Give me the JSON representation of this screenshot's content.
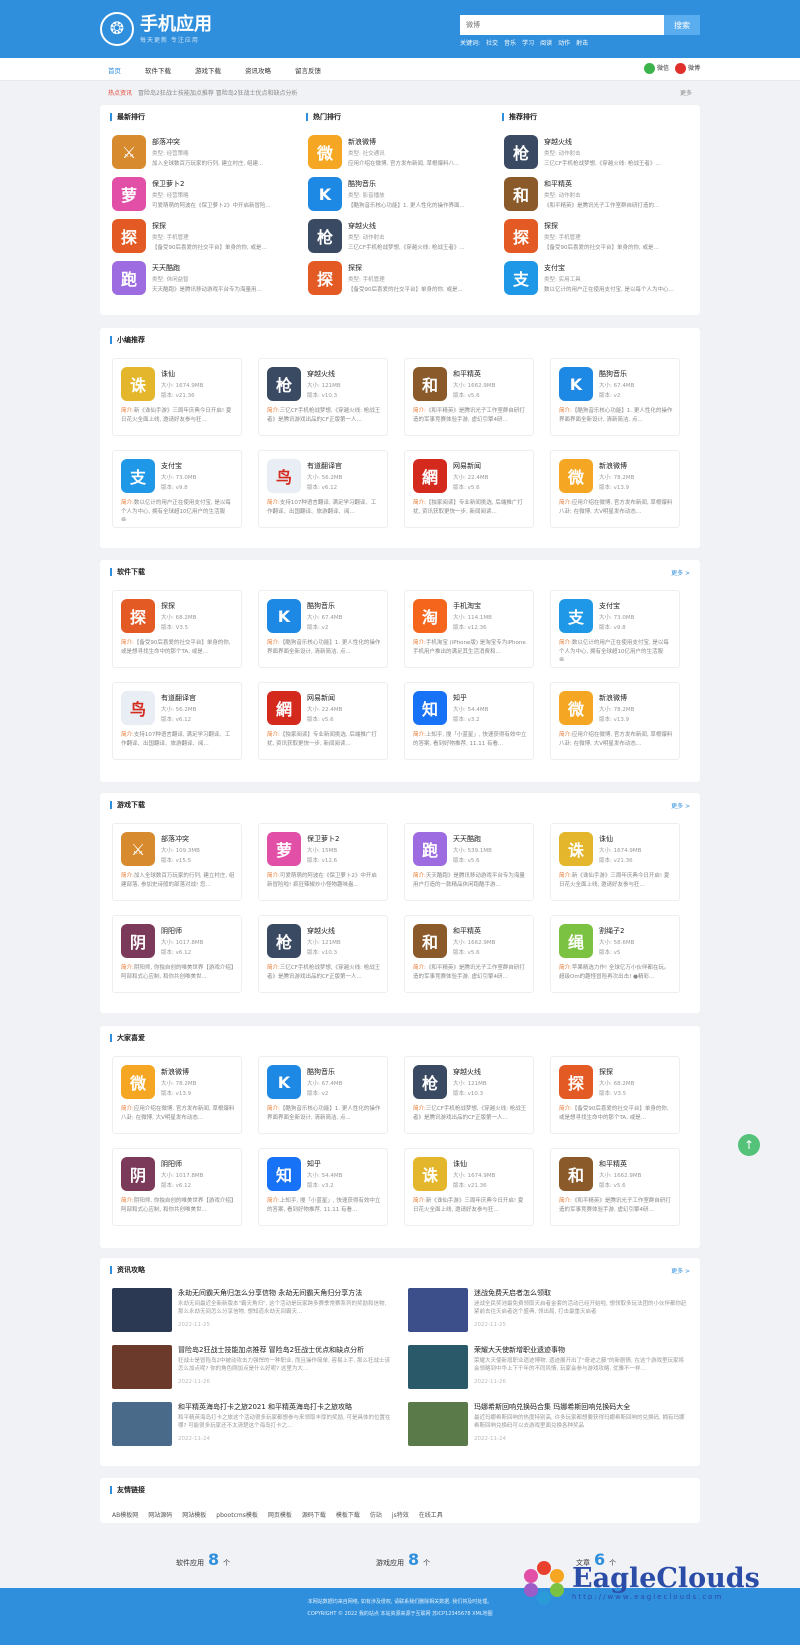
{
  "header": {
    "logo_text": "手机应用",
    "logo_sub": "每天更新  专注应用",
    "search_placeholder": "微博",
    "search_button": "搜索",
    "keywords_label": "关键词:",
    "keywords": [
      "社交",
      "音乐",
      "学习",
      "阅读",
      "动作",
      "射击"
    ]
  },
  "nav": {
    "items": [
      "首页",
      "软件下载",
      "游戏下载",
      "资讯攻略",
      "留言反馈"
    ],
    "share": [
      "微信",
      "微博"
    ]
  },
  "ticker": {
    "label": "热点资讯",
    "text": "冒险岛2狂战士技能加点推荐 冒险岛2狂战士优点和缺点分析",
    "more": "更多"
  },
  "rankings": [
    {
      "title": "最新排行",
      "items": [
        {
          "name": "部落冲突",
          "sub": "类型: 经营策略",
          "desc": "加入全球数百万玩家的行列, 建立村庄, 组建...",
          "icon": "⚔",
          "color": "#d88a2e"
        },
        {
          "name": "保卫萝卜2",
          "sub": "类型: 经营策略",
          "desc": "可爱萌萌的阿波在《保卫萝卜2》中开启新冒险...",
          "icon": "萝",
          "color": "#e24fa7"
        },
        {
          "name": "探探",
          "sub": "类型: 手机管理",
          "desc": "【备受90后喜爱的社交平台】单身的你, 或是...",
          "icon": "探",
          "color": "#e45a24"
        },
        {
          "name": "天天酷跑",
          "sub": "类型: 休闲益智",
          "desc": "天天酷跑》是腾讯移动游戏平台专为海量用...",
          "icon": "跑",
          "color": "#9c6ce0"
        }
      ]
    },
    {
      "title": "热门排行",
      "items": [
        {
          "name": "新浪微博",
          "sub": "类型: 社交通讯",
          "desc": "应用介绍在微博, 官方发布新闻, 草根爆料八...",
          "icon": "微",
          "color": "#f5a623"
        },
        {
          "name": "酷狗音乐",
          "sub": "类型: 影音播放",
          "desc": "【酷狗音乐核心功能】1. 更人性化的操作界面...",
          "icon": "K",
          "color": "#1e88e5"
        },
        {
          "name": "穿越火线",
          "sub": "类型: 动作射击",
          "desc": "三亿CF手机枪战梦想,《穿越火线: 枪战王者》...",
          "icon": "枪",
          "color": "#3a4a63"
        },
        {
          "name": "探探",
          "sub": "类型: 手机管理",
          "desc": "【备受90后喜爱的社交平台】单身的你, 或是...",
          "icon": "探",
          "color": "#e45a24"
        }
      ]
    },
    {
      "title": "推荐排行",
      "items": [
        {
          "name": "穿越火线",
          "sub": "类型: 动作射击",
          "desc": "三亿CF手机枪战梦想,《穿越火线: 枪战王者》...",
          "icon": "枪",
          "color": "#3a4a63"
        },
        {
          "name": "和平精英",
          "sub": "类型: 动作射击",
          "desc": "《和平精英》是腾讯光子工作室群自研打造的...",
          "icon": "和",
          "color": "#8a5a2b"
        },
        {
          "name": "探探",
          "sub": "类型: 手机管理",
          "desc": "【备受90后喜爱的社交平台】单身的你, 或是...",
          "icon": "探",
          "color": "#e45a24"
        },
        {
          "name": "支付宝",
          "sub": "类型: 实用工具",
          "desc": "数以亿计的用户正在使用支付宝, 是以每个人为中心...",
          "icon": "支",
          "color": "#1f98e8"
        }
      ]
    }
  ],
  "sections": [
    {
      "title": "小编推荐",
      "more": "",
      "apps": [
        {
          "name": "诛仙",
          "size": "大小: 1674.9MB",
          "ver": "版本: v21.36",
          "desc": "新《诛仙手游》三周年庆典今日开启! 夏日花火全面上线, 邀请好友参与狂...",
          "icon": "诛",
          "color": "#e3b62b"
        },
        {
          "name": "穿越火线",
          "size": "大小: 121MB",
          "ver": "版本: v10.3",
          "desc": "三亿CF手机枪战梦想,《穿越火线: 枪战王者》是腾讯游戏出品的CF正版第一人...",
          "icon": "枪",
          "color": "#3a4a63"
        },
        {
          "name": "和平精英",
          "size": "大小: 1662.9MB",
          "ver": "版本: v5.6",
          "desc": "《和平精英》是腾讯光子工作室群自研打造的军事竞赛体验手游, 虚幻引擎4研...",
          "icon": "和",
          "color": "#8a5a2b"
        },
        {
          "name": "酷狗音乐",
          "size": "大小: 67.4MB",
          "ver": "版本: v2",
          "desc": "【酷狗音乐核心功能】1. 更人性化的操作界面界面全新设计, 清新简洁, 点...",
          "icon": "K",
          "color": "#1e88e5"
        },
        {
          "name": "支付宝",
          "size": "大小: 73.0MB",
          "ver": "版本: v9.8",
          "desc": "数以亿计的用户正在使用支付宝, 是以每个人为中心, 拥有全球超10亿用户的生活服务...",
          "icon": "支",
          "color": "#1f98e8"
        },
        {
          "name": "有道翻译官",
          "size": "大小: 56.2MB",
          "ver": "版本: v6.12",
          "desc": "支持107种语言翻译, 满足学习翻译、工作翻译、出国翻译、旅游翻译、阅...",
          "icon": "鸟",
          "color": "#e9eef4"
        },
        {
          "name": "网易新闻",
          "size": "大小: 22.4MB",
          "ver": "版本: v5.6",
          "desc": "【独家阅读】专业新闻挑选, 后端推广打扰, 资讯获取更快一步, 新闻阅读...",
          "icon": "網",
          "color": "#d42a1e"
        },
        {
          "name": "新浪微博",
          "size": "大小: 78.2MB",
          "ver": "版本: v13.9",
          "desc": "应用介绍在微博, 官方发布新闻, 草根爆料八卦; 在微博, 大V明星发布动态...",
          "icon": "微",
          "color": "#f5a623"
        }
      ]
    },
    {
      "title": "软件下载",
      "more": "更多 >",
      "apps": [
        {
          "name": "探探",
          "size": "大小: 68.2MB",
          "ver": "版本: V3.5",
          "desc": "【备受90后喜爱的社交平台】单身的你, 或是想寻找生命中的那个TA, 或是...",
          "icon": "探",
          "color": "#e45a24"
        },
        {
          "name": "酷狗音乐",
          "size": "大小: 67.4MB",
          "ver": "版本: v2",
          "desc": "【酷狗音乐核心功能】1. 更人性化的操作界面界面全新设计, 清新简洁, 点...",
          "icon": "K",
          "color": "#1e88e5"
        },
        {
          "name": "手机淘宝",
          "size": "大小: 114.1MB",
          "ver": "版本: v12.36",
          "desc": "手机淘宝 (iPhone版) 是淘宝专为iPhone手机用户推出的满足其生活消费和...",
          "icon": "淘",
          "color": "#f5651c"
        },
        {
          "name": "支付宝",
          "size": "大小: 73.0MB",
          "ver": "版本: v9.8",
          "desc": "数以亿计的用户正在使用支付宝, 是以每个人为中心, 拥有全球超10亿用户的生活服务...",
          "icon": "支",
          "color": "#1f98e8"
        },
        {
          "name": "有道翻译官",
          "size": "大小: 56.2MB",
          "ver": "版本: v6.12",
          "desc": "支持107种语言翻译, 满足学习翻译、工作翻译、出国翻译、旅游翻译、阅...",
          "icon": "鸟",
          "color": "#e9eef4"
        },
        {
          "name": "网易新闻",
          "size": "大小: 22.4MB",
          "ver": "版本: v5.6",
          "desc": "【独家阅读】专业新闻挑选, 后端推广打扰, 资讯获取更快一步, 新闻阅读...",
          "icon": "網",
          "color": "#d42a1e"
        },
        {
          "name": "知乎",
          "size": "大小: 54.4MB",
          "ver": "版本: v3.2",
          "desc": "上知乎, 搜「小蓝星」, 快速获得有效中立的答案, 看到好物推荐, 11.11 有看...",
          "icon": "知",
          "color": "#1772f6"
        },
        {
          "name": "新浪微博",
          "size": "大小: 78.2MB",
          "ver": "版本: v13.9",
          "desc": "应用介绍在微博, 官方发布新闻, 草根爆料八卦; 在微博, 大V明星发布动态...",
          "icon": "微",
          "color": "#f5a623"
        }
      ]
    },
    {
      "title": "游戏下载",
      "more": "更多 >",
      "apps": [
        {
          "name": "部落冲突",
          "size": "大小: 109.3MB",
          "ver": "版本: v15.5",
          "desc": "加入全球数百万玩家的行列, 建立村庄, 组建部落, 参加史诗般的部落对战! 您...",
          "icon": "⚔",
          "color": "#d88a2e"
        },
        {
          "name": "保卫萝卜2",
          "size": "大小: 15MB",
          "ver": "版本: v12.6",
          "desc": "可爱萌萌的阿波在《保卫萝卜2》中开启新冒险啦! 疯狂辣椒炒小怪物趣味盎...",
          "icon": "萝",
          "color": "#e24fa7"
        },
        {
          "name": "天天酷跑",
          "size": "大小: 539.1MB",
          "ver": "版本: v5.6",
          "desc": "天天酷跑》是腾讯移动游戏平台专为海量用户打造的一款精品休闲跑酷手游...",
          "icon": "跑",
          "color": "#9c6ce0"
        },
        {
          "name": "诛仙",
          "size": "大小: 1674.9MB",
          "ver": "版本: v21.36",
          "desc": "新《诛仙手游》三周年庆典今日开启! 夏日花火全面上线, 邀请好友参与狂...",
          "icon": "诛",
          "color": "#e3b62b"
        },
        {
          "name": "阴阳师",
          "size": "大小: 1017.8MB",
          "ver": "版本: v6.12",
          "desc": "阴阳师, 你独自创的唯美世界【游戏介绍】阿部和式心应制, 和你共创唯美世...",
          "icon": "阴",
          "color": "#7c3a5a"
        },
        {
          "name": "穿越火线",
          "size": "大小: 121MB",
          "ver": "版本: v10.3",
          "desc": "三亿CF手机枪战梦想,《穿越火线: 枪战王者》是腾讯游戏出品的CF正版第一人...",
          "icon": "枪",
          "color": "#3a4a63"
        },
        {
          "name": "和平精英",
          "size": "大小: 1662.9MB",
          "ver": "版本: v5.6",
          "desc": "《和平精英》是腾讯光子工作室群自研打造的军事竞赛体验手游, 虚幻引擎4研...",
          "icon": "和",
          "color": "#8a5a2b"
        },
        {
          "name": "割绳子2",
          "size": "大小: 58.6MB",
          "ver": "版本: v5",
          "desc": "苹果精选力作! 全球亿万小伙伴都在玩。超级Om的趣怪冒险再次出击! ●精彩...",
          "icon": "绳",
          "color": "#7cc242"
        }
      ]
    },
    {
      "title": "大家喜爱",
      "more": "",
      "apps": [
        {
          "name": "新浪微博",
          "size": "大小: 78.2MB",
          "ver": "版本: v13.9",
          "desc": "应用介绍在微博, 官方发布新闻, 草根爆料八卦; 在微博, 大V明星发布动态...",
          "icon": "微",
          "color": "#f5a623"
        },
        {
          "name": "酷狗音乐",
          "size": "大小: 67.4MB",
          "ver": "版本: v2",
          "desc": "【酷狗音乐核心功能】1. 更人性化的操作界面界面全新设计, 清新简洁, 点...",
          "icon": "K",
          "color": "#1e88e5"
        },
        {
          "name": "穿越火线",
          "size": "大小: 121MB",
          "ver": "版本: v10.3",
          "desc": "三亿CF手机枪战梦想,《穿越火线: 枪战王者》是腾讯游戏出品的CF正版第一人...",
          "icon": "枪",
          "color": "#3a4a63"
        },
        {
          "name": "探探",
          "size": "大小: 68.2MB",
          "ver": "版本: V3.5",
          "desc": "【备受90后喜爱的社交平台】单身的你, 或是想寻找生命中的那个TA, 或是...",
          "icon": "探",
          "color": "#e45a24"
        },
        {
          "name": "阴阳师",
          "size": "大小: 1017.8MB",
          "ver": "版本: v6.12",
          "desc": "阴阳师, 你独自创的唯美世界【游戏介绍】阿部和式心应制, 和你共创唯美世...",
          "icon": "阴",
          "color": "#7c3a5a"
        },
        {
          "name": "知乎",
          "size": "大小: 54.4MB",
          "ver": "版本: v3.2",
          "desc": "上知乎, 搜「小蓝星」, 快速获得有效中立的答案, 看到好物推荐, 11.11 有看...",
          "icon": "知",
          "color": "#1772f6"
        },
        {
          "name": "诛仙",
          "size": "大小: 1674.9MB",
          "ver": "版本: v21.36",
          "desc": "新《诛仙手游》三周年庆典今日开启! 夏日花火全面上线, 邀请好友参与狂...",
          "icon": "诛",
          "color": "#e3b62b"
        },
        {
          "name": "和平精英",
          "size": "大小: 1662.9MB",
          "ver": "版本: v5.6",
          "desc": "《和平精英》是腾讯光子工作室群自研打造的军事竞赛体验手游, 虚幻引擎4研...",
          "icon": "和",
          "color": "#8a5a2b"
        }
      ]
    }
  ],
  "intro_label": "简介:",
  "news": {
    "title": "资讯攻略",
    "more": "更多 >",
    "items": [
      {
        "title": "永劫无间霸天角归怎么分享信物 永劫无间霸天角归分享方法",
        "desc": "永劫无间最近全新新版本\"霸天角归\", 这个活动是玩家跨多赛季常赛系列的奖励和信物, 那么永劫无间怎么分享信物, 想知道永劫无间霸天...",
        "date": "2022-11-25",
        "color": "#2b3a52"
      },
      {
        "title": "迷战免费天启者怎么领取",
        "desc": "迷战全民奖池最免费领取天启者金套的活动已经开始啦, 想领取多玩法团的小伙伴都你赶紧前去往天启者这个盛典, 领出局, 打击最重天启者",
        "date": "2022-11-25",
        "color": "#3d4f8a"
      },
      {
        "title": "冒险岛2狂战士技能加点推荐 冒险岛2狂战士优点和缺点分析",
        "desc": "狂战士是冒险岛2中被动攻击力强悍的一种职业, 而且操作简单, 容易上手, 那么狂战士该怎么加点呢? 你的角色刚加点是什么好呢? 这里为大...",
        "date": "2022-11-26",
        "color": "#6b3a2a"
      },
      {
        "title": "荣耀大天使新增职业遗迹事物",
        "desc": "荣耀大天使新增职业遗迹博物, 遗迹展开出了\"奇迹之藤\"的新剧情, 在这个游戏里玩家将会领略到中华上下千年的不同风情, 玩家会参与游戏攻略, 优雅不一样...",
        "date": "2022-11-26",
        "color": "#2a5a6a"
      },
      {
        "title": "和平精英海岛打卡之旅2021 和平精英海岛打卡之旅攻略",
        "desc": "和平精英海岛打卡之旅这个活动很多玩家都想参与来领取丰厚的奖励, 可是具体的位置在哪? 可能很多玩家还不太清楚这个海岛打卡之...",
        "date": "2022-11-24",
        "color": "#4a6a8a"
      },
      {
        "title": "玛娜希斯回响兑换码合集 玛娜希斯回响兑换码大全",
        "desc": "最近玛娜希斯回响的热度特别高, 许多玩家都想要获得玛娜希斯回响的兑换码, 拥有玛娜希斯回响兑换码可以去游戏里面兑换各种奖品",
        "date": "2022-11-24",
        "color": "#5a7a4a"
      }
    ]
  },
  "friend_links": {
    "title": "友情链接",
    "items": [
      "AB模板网",
      "网站源码",
      "网站模板",
      "pbootcms模板",
      "网页模板",
      "源码下载",
      "模板下载",
      "仿站",
      "js特效",
      "在线工具"
    ]
  },
  "stats": [
    {
      "label": "软件应用",
      "num": "8",
      "unit": "个"
    },
    {
      "label": "游戏应用",
      "num": "8",
      "unit": "个"
    },
    {
      "label": "文章",
      "num": "6",
      "unit": "个"
    }
  ],
  "footer": {
    "line1": "本网站数据均来自网络, 如有涉及侵权, 请联系我们删除相关数据, 我们将及时处理。",
    "line2": "COPYRIGHT © 2022 我的站点 本站资源来源于互联网 苏ICP12345678 XML地图"
  },
  "watermark": {
    "name": "EagleClouds",
    "url": "http://www.eagleclouds.com"
  },
  "back_to_top": "↑"
}
